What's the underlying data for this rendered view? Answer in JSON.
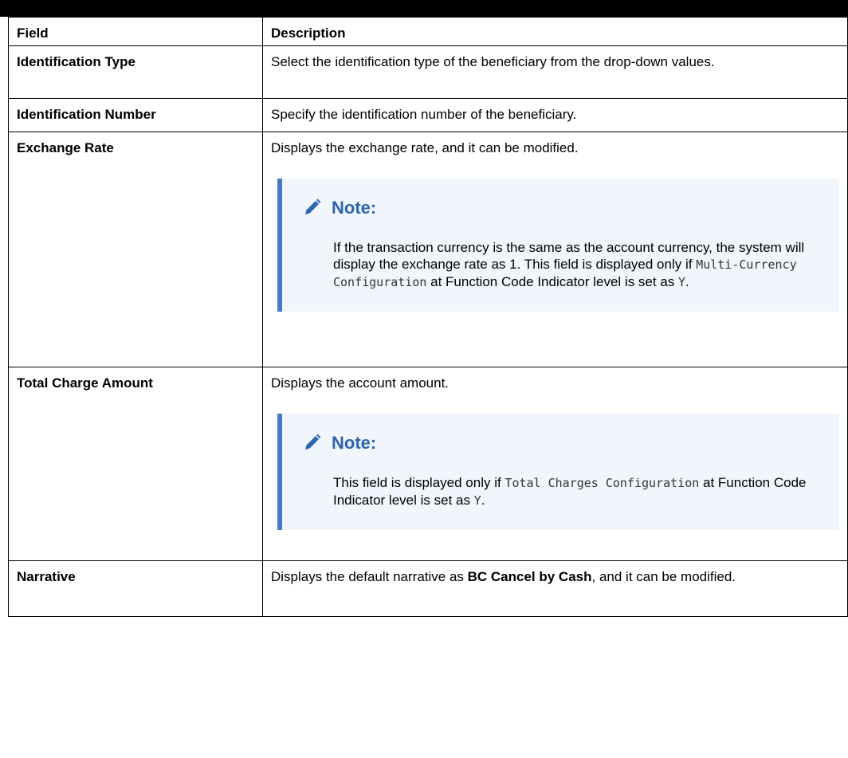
{
  "table": {
    "headers": {
      "field": "Field",
      "description": "Description"
    },
    "rows": [
      {
        "field": "Identification Type",
        "description": "Select the identification type of the beneficiary from the drop-down values."
      },
      {
        "field": "Identification Number",
        "description": "Specify the identification number of the beneficiary."
      },
      {
        "field": "Exchange Rate",
        "description": "Displays the exchange rate, and it can be modified.",
        "note": {
          "title": "Note:",
          "line1": "If the transaction currency is the same as the account currency, the system will display the exchange rate as 1.",
          "prefix": "This field is displayed only if ",
          "code": "Multi-Currency Configuration",
          "middle": " at Function Code Indicator level is set as ",
          "value": "Y",
          "suffix": "."
        }
      },
      {
        "field": "Total Charge Amount",
        "description": "Displays the account amount.",
        "note": {
          "title": "Note:",
          "prefix": "This field is displayed only if ",
          "code": "Total Charges Configuration",
          "middle": " at Function Code Indicator level is set as ",
          "value": "Y",
          "suffix": "."
        }
      },
      {
        "field": "Narrative",
        "description_prefix": "Displays the default narrative as ",
        "description_bold": "BC Cancel by Cash",
        "description_suffix": ", and it can be modified."
      }
    ]
  },
  "icons": {
    "note": "pencil-icon"
  },
  "colors": {
    "note_title": "#2d65b0",
    "note_border": "#4b7ac4",
    "note_bg": "#f1f6fc"
  }
}
